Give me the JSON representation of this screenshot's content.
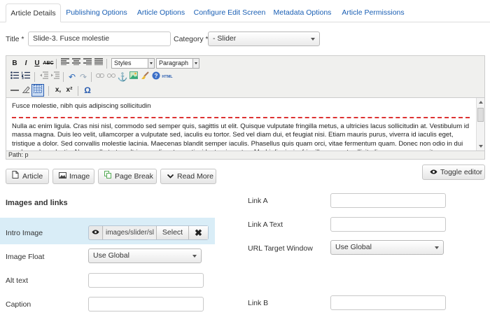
{
  "tabs": [
    {
      "label": "Article Details",
      "active": true
    },
    {
      "label": "Publishing Options"
    },
    {
      "label": "Article Options"
    },
    {
      "label": "Configure Edit Screen"
    },
    {
      "label": "Metadata Options"
    },
    {
      "label": "Article Permissions"
    }
  ],
  "title_field": {
    "label": "Title",
    "required_mark": "*",
    "value": "Slide-3. Fusce molestie"
  },
  "category_field": {
    "label": "Category",
    "required_mark": "*",
    "value": "- Slider"
  },
  "editor": {
    "toolbar": {
      "styles_select": "Styles",
      "format_select": "Paragraph",
      "icons": [
        "bold-icon",
        "italic-icon",
        "underline-icon",
        "strikethrough-icon",
        "align-left-icon",
        "align-center-icon",
        "align-right-icon",
        "align-justify-icon",
        "bullet-list-icon",
        "numbered-list-icon",
        "outdent-icon",
        "indent-icon",
        "undo-icon",
        "redo-icon",
        "link-icon",
        "unlink-icon",
        "anchor-icon",
        "image-icon",
        "cleanup-icon",
        "help-icon",
        "html-icon",
        "horizontal-rule-icon",
        "remove-format-icon",
        "visual-aid-icon",
        "subscript-icon",
        "superscript-icon",
        "special-char-icon"
      ],
      "glyphs": {
        "bold": "B",
        "italic": "I",
        "underline": "U",
        "strike": "ABC",
        "sub": "x,",
        "sup": "x²",
        "omega": "Ω",
        "html": "HTML"
      }
    },
    "content": {
      "first_line": "Fusce molestie, nibh quis adipiscing sollicitudin",
      "paragraph": "Nulla ac enim ligula. Cras nisi nisl, commodo sed semper quis, sagittis ut elit. Quisque vulputate fringilla metus, a ultricies lacus sollicitudin at. Vestibulum id massa magna. Duis leo velit, ullamcorper a vulputate sed, iaculis eu tortor. Sed vel diam dui, et feugiat nisi. Etiam mauris purus, viverra id iaculis eget, tristique a dolor. Sed convallis molestie lacinia. Maecenas blandit semper iaculis. Phasellus quis quam orci, vitae fermentum quam. Donec non odio in dui malesuada molestie. Nunc nulla tortor, ultrices a aliquet non, tincidunt quis metus. Morbi dignissim fringilla nunc, ut sollicitudin magna ornare vitae."
    },
    "path": "Path: p"
  },
  "editor_buttons": {
    "article": "Article",
    "image": "Image",
    "page_break": "Page Break",
    "read_more": "Read More",
    "toggle_editor": "Toggle editor"
  },
  "images_links": {
    "heading": "Images and links",
    "intro_image": {
      "label": "Intro Image",
      "path": "images/slider/sl",
      "select": "Select",
      "clear": "✖"
    },
    "image_float": {
      "label": "Image Float",
      "value": "Use Global"
    },
    "alt_text": {
      "label": "Alt text",
      "value": ""
    },
    "caption": {
      "label": "Caption",
      "value": ""
    },
    "link_a": {
      "label": "Link A",
      "value": ""
    },
    "link_a_text": {
      "label": "Link A Text",
      "value": ""
    },
    "url_target": {
      "label": "URL Target Window",
      "value": "Use Global"
    },
    "link_b": {
      "label": "Link B",
      "value": ""
    }
  }
}
